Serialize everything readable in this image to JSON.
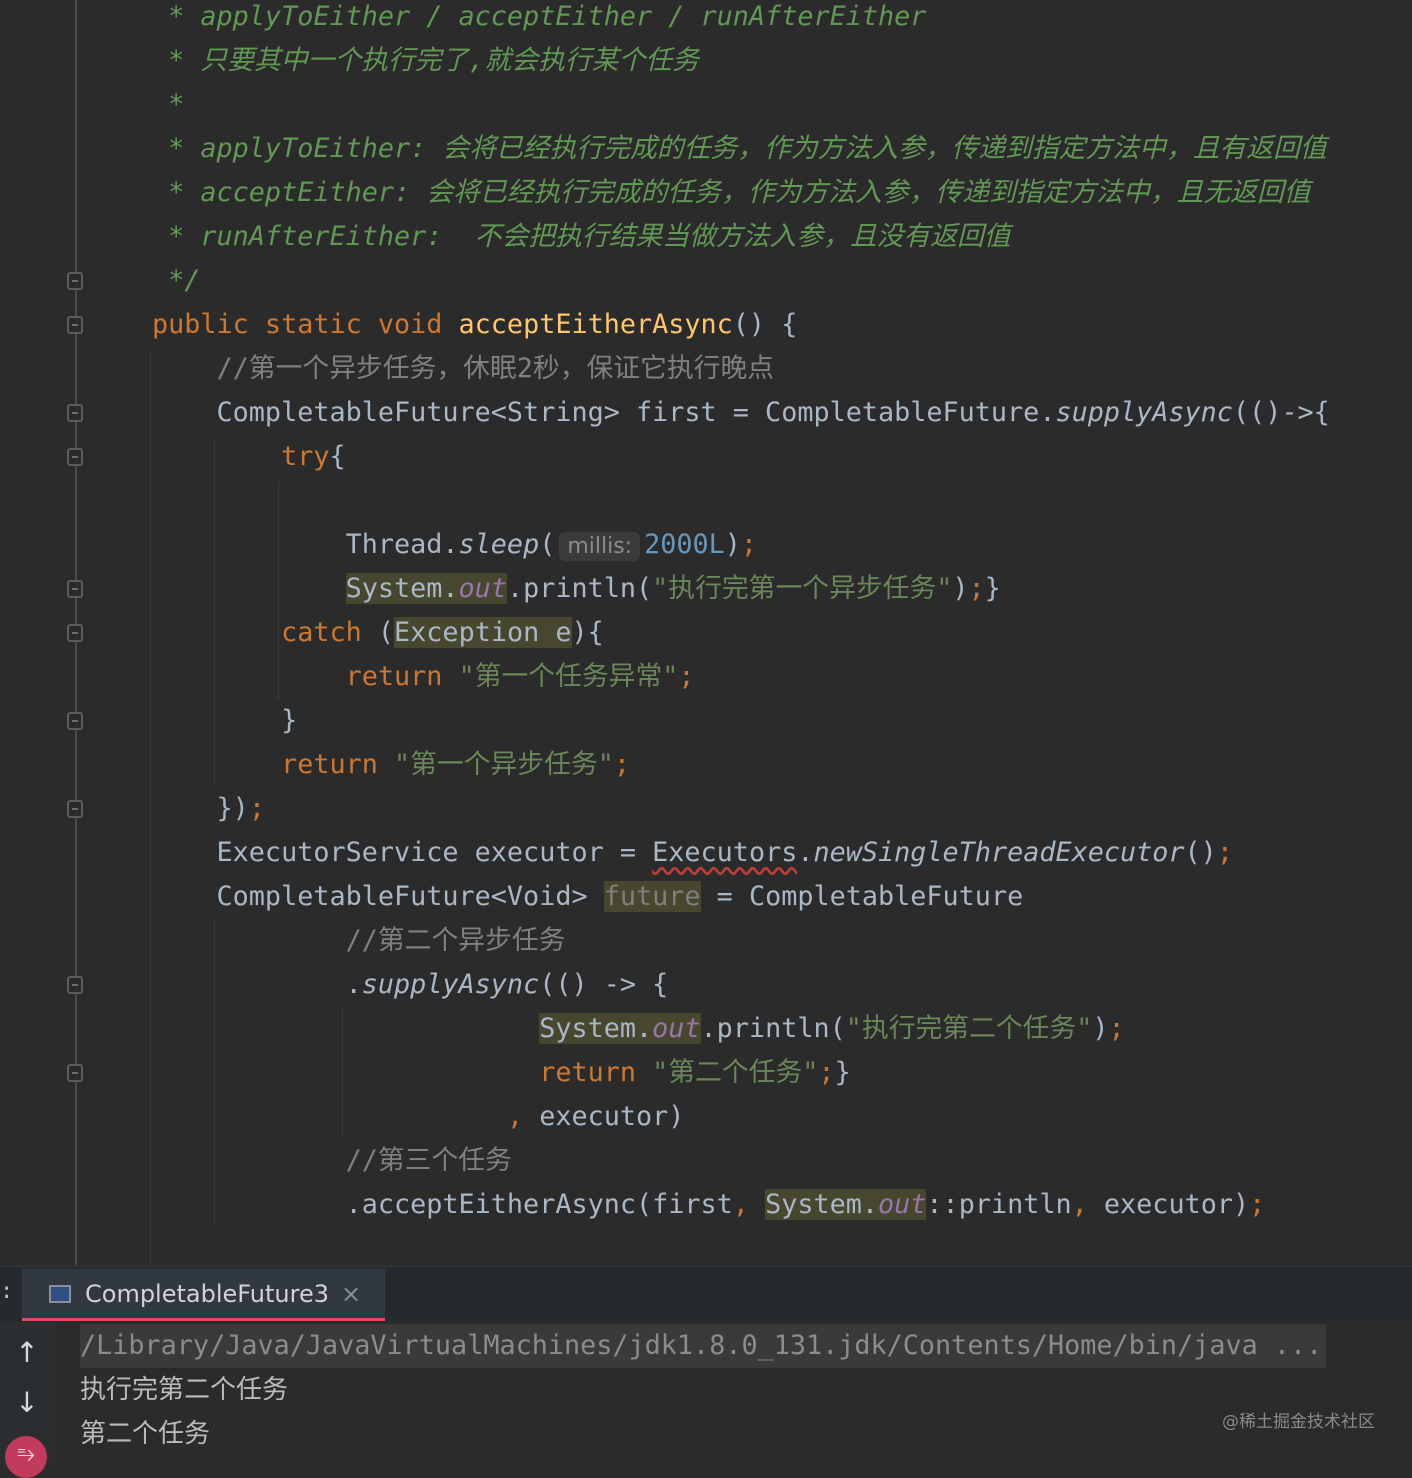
{
  "editor": {
    "lines": [
      [
        [
          " * applyToEither / acceptEither / runAfterEither",
          "doc"
        ]
      ],
      [
        [
          " * 只要其中一个执行完了,就会执行某个任务",
          "doc"
        ]
      ],
      [
        [
          " *",
          "doc"
        ]
      ],
      [
        [
          " * applyToEither: 会将已经执行完成的任务，作为方法入参，传递到指定方法中，且有返回值",
          "doc"
        ]
      ],
      [
        [
          " * acceptEither: 会将已经执行完成的任务，作为方法入参，传递到指定方法中，且无返回值",
          "doc"
        ]
      ],
      [
        [
          " * runAfterEither:  不会把执行结果当做方法入参，且没有返回值",
          "doc"
        ]
      ],
      [
        [
          " */",
          "doc"
        ]
      ],
      [
        [
          "public static void ",
          "kw"
        ],
        [
          "acceptEitherAsync",
          "fn"
        ],
        [
          "() {",
          ""
        ]
      ],
      [
        [
          "    //第一个异步任务，休眠2秒，保证它执行晚点",
          "cm"
        ]
      ],
      [
        [
          "    CompletableFuture<String> first = CompletableFuture.",
          ""
        ],
        [
          "supplyAsync",
          "st"
        ],
        [
          "(()->{",
          ""
        ]
      ],
      [
        [
          "        ",
          ""
        ],
        [
          "try",
          "kw"
        ],
        [
          "{",
          ""
        ]
      ],
      [],
      [
        [
          "            Thread.",
          ""
        ],
        [
          "sleep",
          "st"
        ],
        [
          "(",
          ""
        ],
        [
          "millis:",
          "hint"
        ],
        [
          "2000L",
          "num"
        ],
        [
          ")",
          ""
        ],
        [
          ";",
          "kw"
        ]
      ],
      [
        [
          "            ",
          ""
        ],
        [
          "System.",
          "hl"
        ],
        [
          "out",
          "hlf"
        ],
        [
          ".println(",
          ""
        ],
        [
          "\"执行完第一个异步任务\"",
          "str"
        ],
        [
          ")",
          ""
        ],
        [
          ";",
          "kw"
        ],
        [
          "}",
          ""
        ]
      ],
      [
        [
          "        ",
          ""
        ],
        [
          "catch",
          "kw"
        ],
        [
          " (",
          ""
        ],
        [
          "Exception e",
          "hl"
        ],
        [
          "){",
          ""
        ]
      ],
      [
        [
          "            ",
          ""
        ],
        [
          "return",
          "kw"
        ],
        [
          " ",
          ""
        ],
        [
          "\"第一个任务异常\"",
          "str"
        ],
        [
          ";",
          "kw"
        ]
      ],
      [
        [
          "        }",
          ""
        ]
      ],
      [
        [
          "        ",
          ""
        ],
        [
          "return",
          "kw"
        ],
        [
          " ",
          ""
        ],
        [
          "\"第一个异步任务\"",
          "str"
        ],
        [
          ";",
          "kw"
        ]
      ],
      [
        [
          "    })",
          ""
        ],
        [
          ";",
          "kw"
        ]
      ],
      [
        [
          "    ExecutorService executor = ",
          ""
        ],
        [
          "Executors",
          "err"
        ],
        [
          ".",
          ""
        ],
        [
          "newSingleThreadExecutor",
          "st"
        ],
        [
          "()",
          ""
        ],
        [
          ";",
          "kw"
        ]
      ],
      [
        [
          "    CompletableFuture<Void> ",
          ""
        ],
        [
          "future",
          "unused"
        ],
        [
          " = CompletableFuture",
          ""
        ]
      ],
      [
        [
          "            //第二个异步任务",
          "cm"
        ]
      ],
      [
        [
          "            .",
          ""
        ],
        [
          "supplyAsync",
          "st"
        ],
        [
          "(() -> {",
          ""
        ]
      ],
      [
        [
          "                        ",
          ""
        ],
        [
          "System.",
          "hl"
        ],
        [
          "out",
          "hlf"
        ],
        [
          ".println(",
          ""
        ],
        [
          "\"执行完第二个任务\"",
          "str"
        ],
        [
          ")",
          ""
        ],
        [
          ";",
          "kw"
        ]
      ],
      [
        [
          "                        ",
          ""
        ],
        [
          "return",
          "kw"
        ],
        [
          " ",
          ""
        ],
        [
          "\"第二个任务\"",
          "str"
        ],
        [
          ";",
          "kw"
        ],
        [
          "}",
          ""
        ]
      ],
      [
        [
          "                      ",
          ""
        ],
        [
          ",",
          "kw"
        ],
        [
          " executor)",
          ""
        ]
      ],
      [
        [
          "            //第三个任务",
          "cm"
        ]
      ],
      [
        [
          "            .acceptEitherAsync(first",
          ""
        ],
        [
          ", ",
          "kw"
        ],
        [
          "System.",
          "hl"
        ],
        [
          "out",
          "hlf"
        ],
        [
          "::println",
          ""
        ],
        [
          ", ",
          "kw"
        ],
        [
          "executor)",
          ""
        ],
        [
          ";",
          "kw"
        ]
      ]
    ]
  },
  "run_panel": {
    "colon": ":",
    "tab_label": "CompletableFuture3",
    "tab_close": "×",
    "up_icon": "↑",
    "down_icon": "↓",
    "wrap_icon": "⥱",
    "output": [
      "/Library/Java/JavaVirtualMachines/jdk1.8.0_131.jdk/Contents/Home/bin/java ...",
      "执行完第二个任务",
      "第二个任务"
    ],
    "watermark": "@稀土掘金技术社区"
  },
  "colors": {
    "keyword": "#cc7832",
    "string": "#6a8759",
    "doc": "#629755",
    "accent": "#e34b64"
  }
}
